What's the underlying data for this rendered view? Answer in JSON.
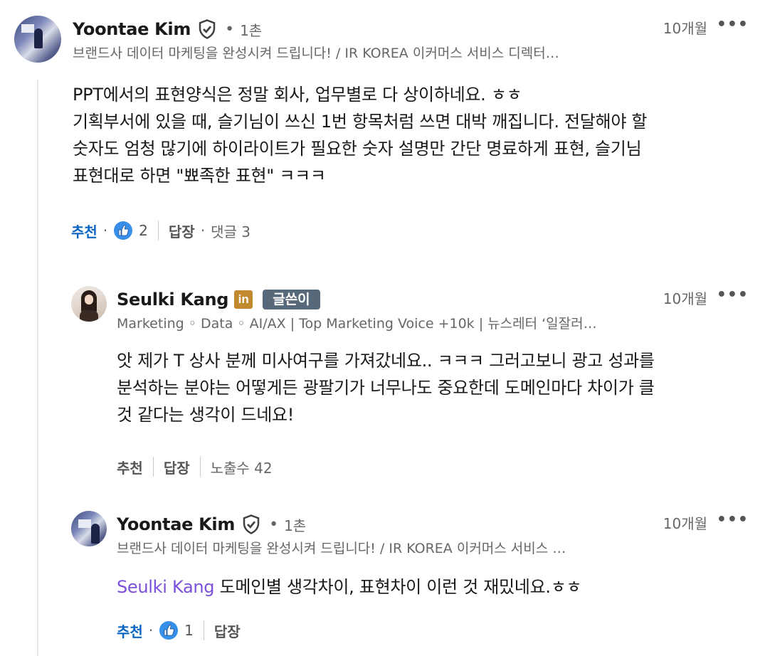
{
  "comments": [
    {
      "author": "Yoontae Kim",
      "degree": "1촌",
      "headline": "브랜드사 데이터 마케팅을 완성시켜 드립니다! / IR KOREA 이커머스 서비스 디렉터…",
      "time": "10개월",
      "more": "•••",
      "text": [
        "PPT에서의 표현양식은 정말 회사, 업무별로 다 상이하네요. ㅎㅎ",
        "기획부서에 있을 때, 슬기님이 쓰신 1번 항목처럼 쓰면 대박 깨집니다. 전달해야 할",
        "숫자도 엄청 많기에 하이라이트가 필요한 숫자 설명만 간단 명료하게 표현, 슬기님",
        "표현대로 하면 \"뾰족한 표현\" ㅋㅋㅋ"
      ],
      "actions": {
        "like": "추천",
        "like_count": "2",
        "reply": "답장",
        "replies": "댓글 3"
      }
    },
    {
      "author": "Seulki Kang",
      "author_badge": "글쓴이",
      "linkedin_badge": "in",
      "headline": "Marketing ◦ Data ◦ AI/AX | Top Marketing Voice +10k | 뉴스레터 ‘일잘러…",
      "time": "10개월",
      "more": "•••",
      "text": [
        "앗 제가 T 상사 분께 미사여구를 가져갔네요.. ㅋㅋㅋ 그러고보니 광고 성과를",
        "분석하는 분야는 어떻게든 광팔기가 너무나도 중요한데 도메인마다 차이가 클",
        "것 같다는 생각이 드네요!"
      ],
      "actions": {
        "like": "추천",
        "reply": "답장",
        "impressions": "노출수 42"
      }
    },
    {
      "author": "Yoontae Kim",
      "degree": "1촌",
      "headline": "브랜드사 데이터 마케팅을 완성시켜 드립니다! / IR KOREA 이커머스 서비스 …",
      "time": "10개월",
      "more": "•••",
      "mention": "Seulki Kang",
      "text_after_mention": " 도메인별 생각차이, 표현차이 이런 것 재밌네요.ㅎㅎ",
      "actions": {
        "like": "추천",
        "like_count": "1",
        "reply": "답장"
      }
    }
  ],
  "colors": {
    "link_blue": "#0a66c2",
    "mention_purple": "#7c4fd8",
    "badge_gray": "#56687a",
    "linkedin_gold": "#c18a2e"
  }
}
